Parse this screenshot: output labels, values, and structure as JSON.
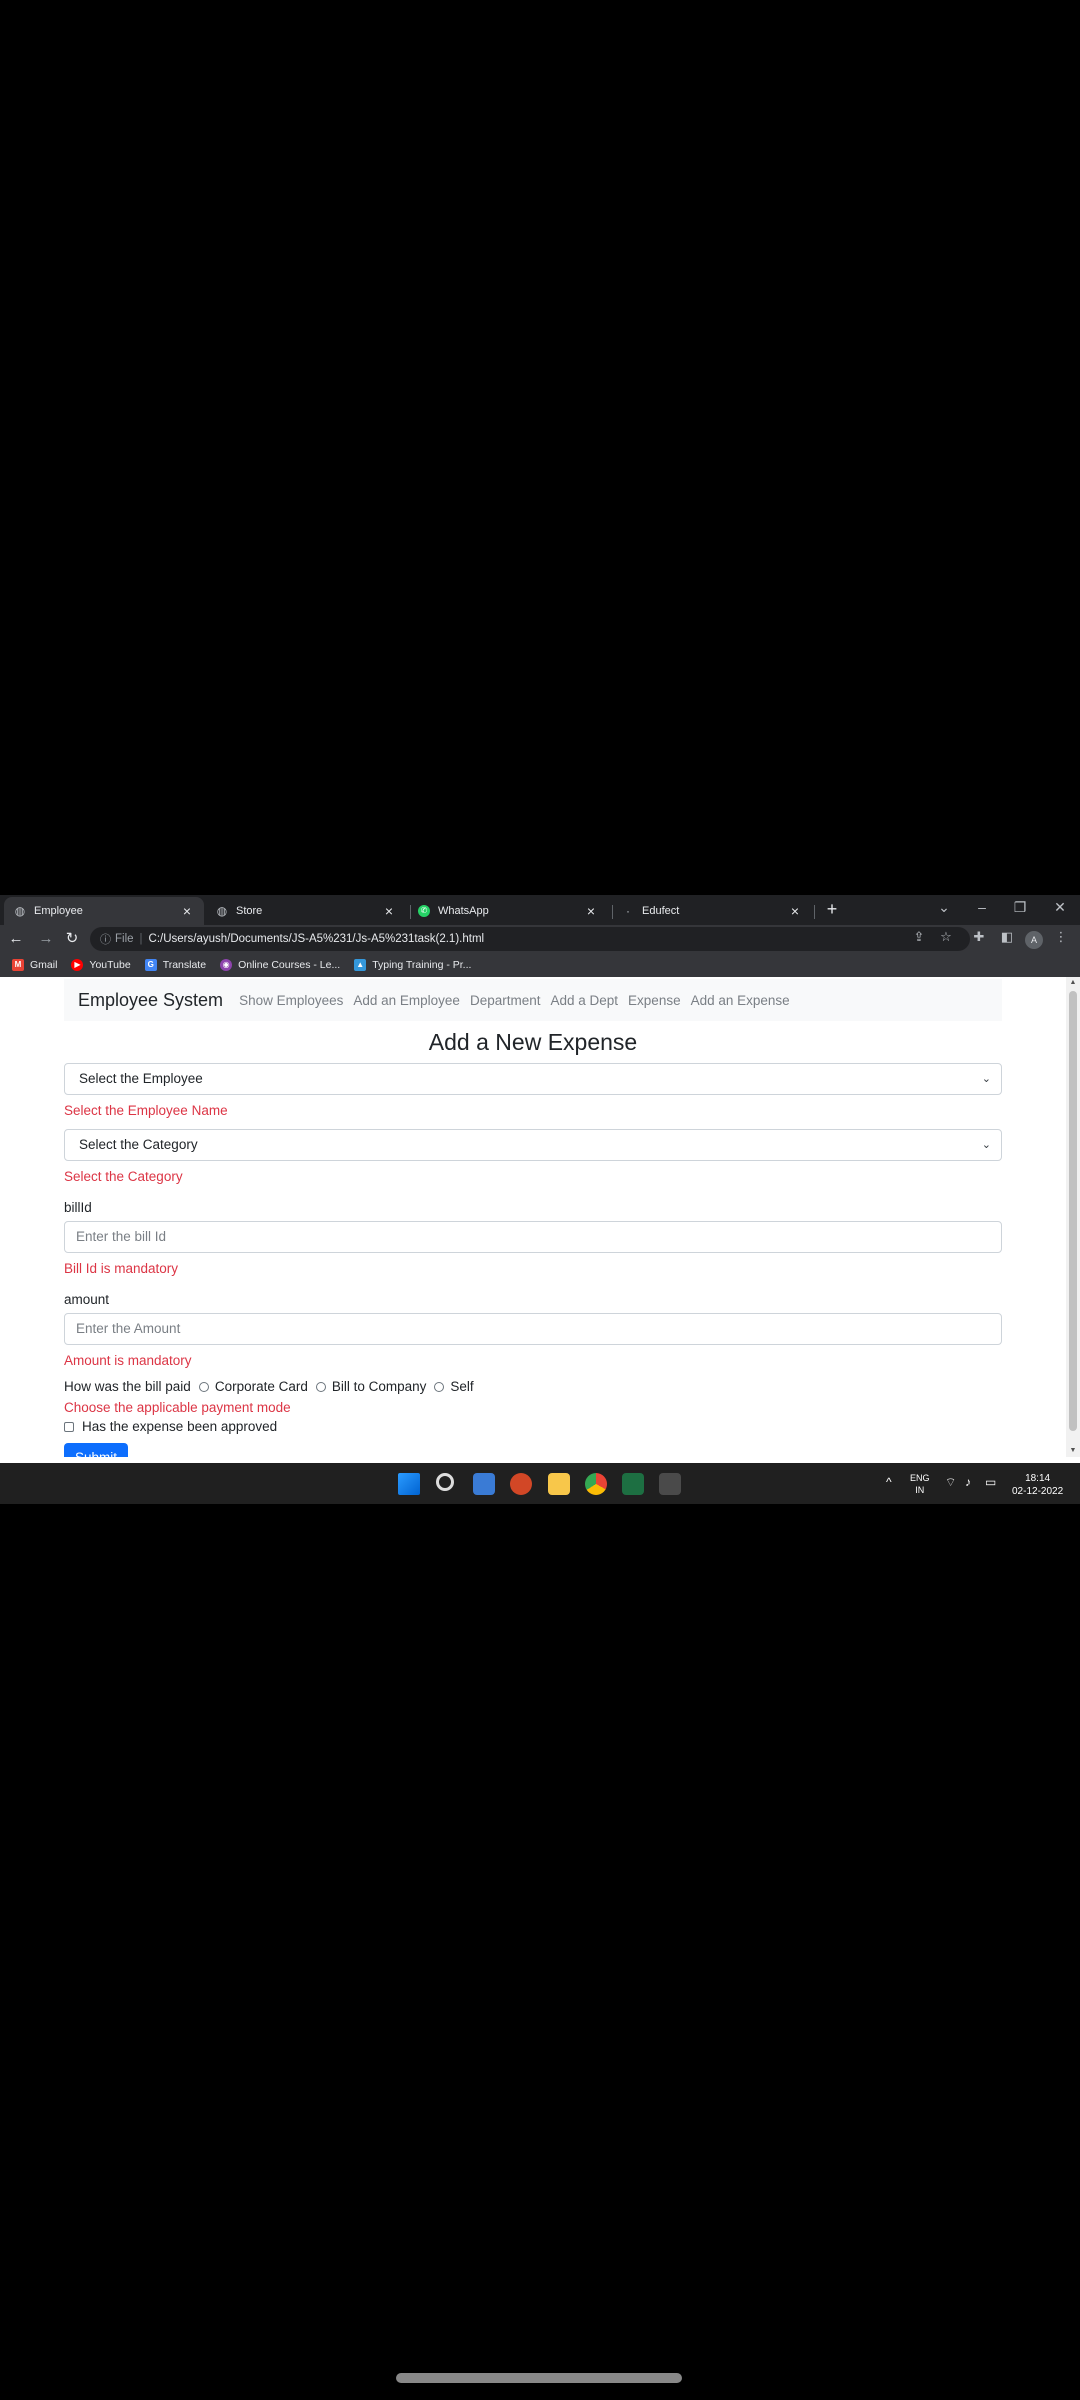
{
  "browser": {
    "tabs": [
      {
        "title": "Employee",
        "active": true
      },
      {
        "title": "Store",
        "active": false
      },
      {
        "title": "WhatsApp",
        "active": false
      },
      {
        "title": "Edufect",
        "active": false
      }
    ],
    "address": {
      "prefix": "File",
      "url": "C:/Users/ayush/Documents/JS-A5%231/Js-A5%231task(2.1).html"
    },
    "avatar_initial": "A",
    "bookmarks": [
      {
        "label": "Gmail",
        "icon": "gmail-icon",
        "color": "#ea4335"
      },
      {
        "label": "YouTube",
        "icon": "youtube-icon",
        "color": "#ff0000"
      },
      {
        "label": "Translate",
        "icon": "translate-icon",
        "color": "#4285f4"
      },
      {
        "label": "Online Courses - Le...",
        "icon": "courses-icon",
        "color": "#8e44ad"
      },
      {
        "label": "Typing Training - Pr...",
        "icon": "typing-icon",
        "color": "#3498db"
      }
    ]
  },
  "page": {
    "brand": "Employee System",
    "nav": [
      "Show Employees",
      "Add an Employee",
      "Department",
      "Add a Dept",
      "Expense",
      "Add an Expense"
    ],
    "title": "Add a New Expense",
    "employee_select": {
      "value": "Select the Employee",
      "error": "Select the Employee Name"
    },
    "category_select": {
      "value": "Select the Category",
      "error": "Select the Category"
    },
    "billid": {
      "label": "billId",
      "placeholder": "Enter the bill Id",
      "error": "Bill Id is mandatory"
    },
    "amount": {
      "label": "amount",
      "placeholder": "Enter the Amount",
      "error": "Amount is mandatory"
    },
    "payment": {
      "question": "How was the bill paid",
      "options": [
        "Corporate Card",
        "Bill to Company",
        "Self"
      ],
      "error": "Choose the applicable payment mode"
    },
    "approved_label": "Has the expense been approved",
    "submit_label": "Submit"
  },
  "taskbar": {
    "lang_line1": "ENG",
    "lang_line2": "IN",
    "time": "18:14",
    "date": "02-12-2022"
  },
  "colors": {
    "accent": "#0d6efd",
    "error": "#dc3545",
    "chrome_dark": "#202124"
  }
}
